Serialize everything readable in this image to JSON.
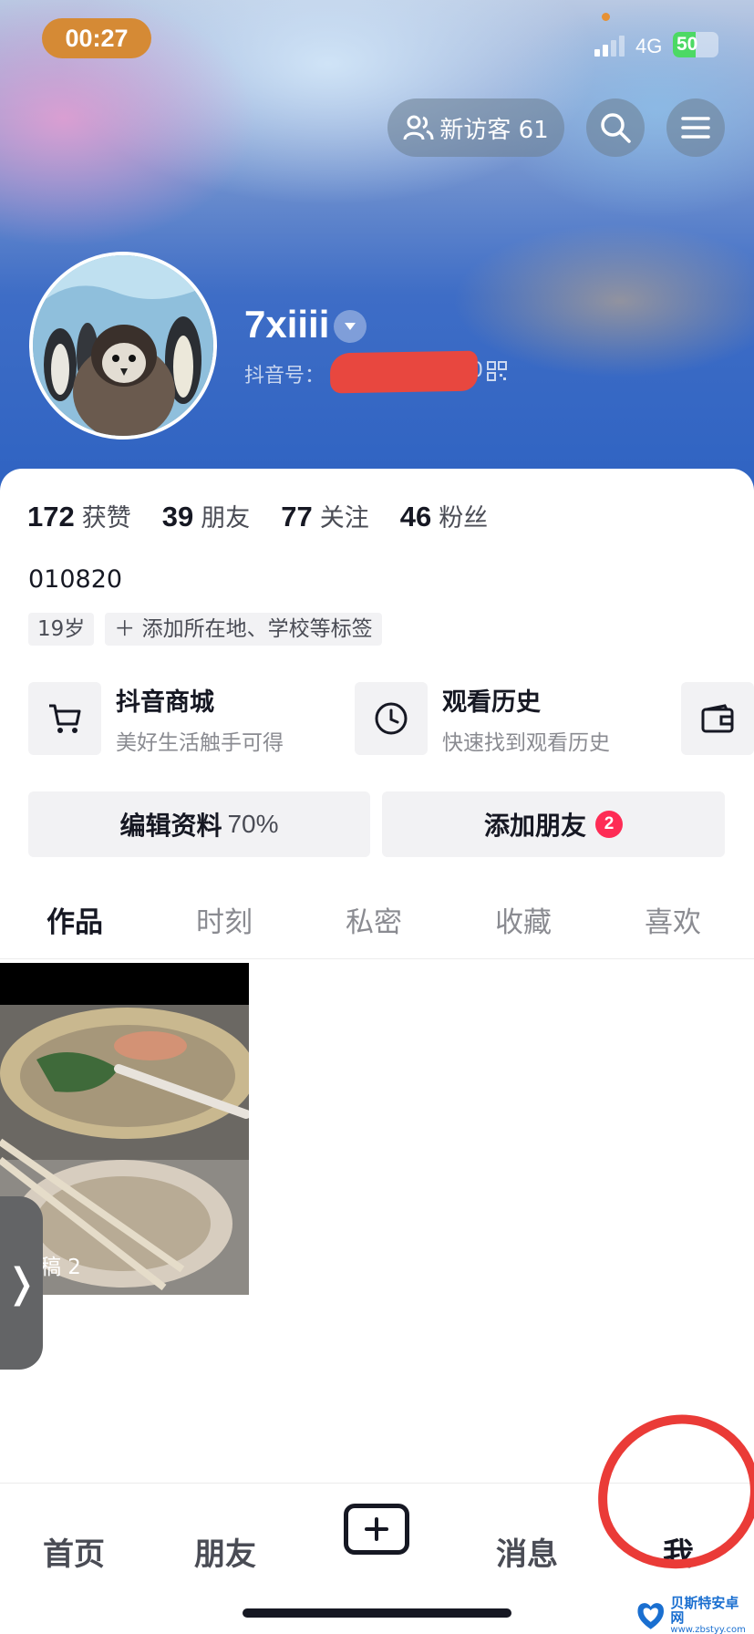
{
  "status_bar": {
    "time": "00:27",
    "network": "4G",
    "battery_level": "50",
    "battery_fraction": 0.5
  },
  "header": {
    "visitor_label": "新访客 61",
    "search_icon": "search-icon",
    "menu_icon": "menu-icon"
  },
  "profile": {
    "username": "7xiiii",
    "douyin_id_label": "抖音号：",
    "douyin_id_tail": "0"
  },
  "stats": [
    {
      "num": "172",
      "label": "获赞"
    },
    {
      "num": "39",
      "label": "朋友"
    },
    {
      "num": "77",
      "label": "关注"
    },
    {
      "num": "46",
      "label": "粉丝"
    }
  ],
  "bio": "010820",
  "tags": {
    "age": "19岁",
    "add_tag": "添加所在地、学校等标签"
  },
  "services": [
    {
      "title": "抖音商城",
      "subtitle": "美好生活触手可得",
      "icon": "cart-icon"
    },
    {
      "title": "观看历史",
      "subtitle": "快速找到观看历史",
      "icon": "clock-icon"
    },
    {
      "icon": "wallet-icon"
    }
  ],
  "actions": {
    "edit_label": "编辑资料",
    "edit_percent": "70%",
    "add_friend_label": "添加朋友",
    "add_friend_badge": "2"
  },
  "tabs": [
    "作品",
    "时刻",
    "私密",
    "收藏",
    "喜欢"
  ],
  "videos": [
    {
      "caption": "稿 2"
    }
  ],
  "side_handle": "❭",
  "bottom_nav": {
    "home": "首页",
    "friends": "朋友",
    "messages": "消息",
    "me": "我"
  },
  "watermark": {
    "title": "贝斯特安卓网",
    "url": "www.zbstyy.com"
  },
  "colors": {
    "accent_red": "#fe2c55",
    "annotation_red": "#ea3b37",
    "time_pill": "#d58a35"
  }
}
